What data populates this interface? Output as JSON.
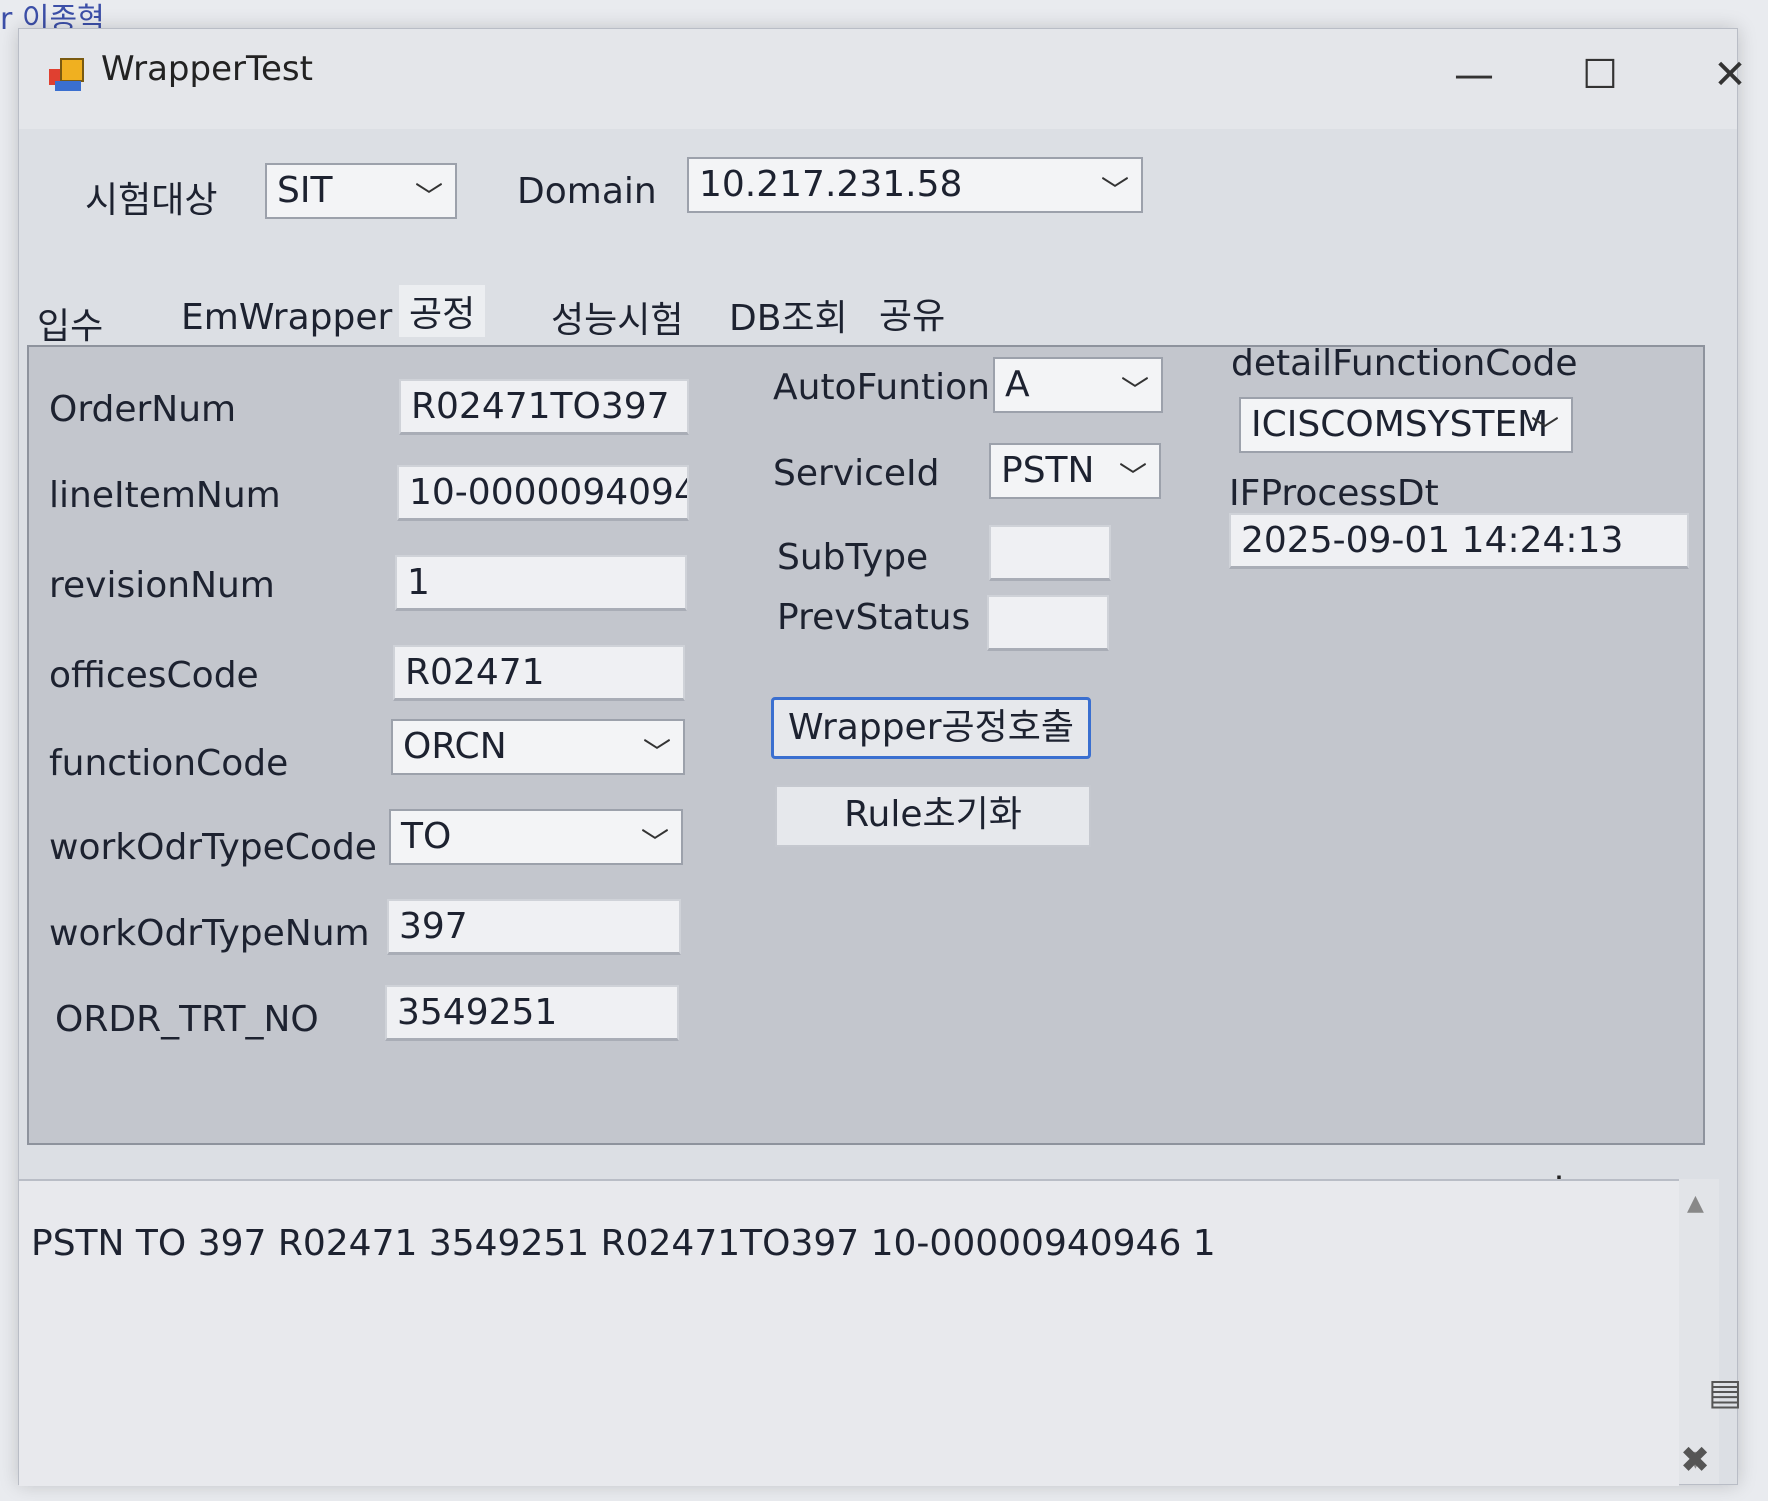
{
  "background": {
    "corner_text": "r 이종혁"
  },
  "window": {
    "title": "WrapperTest",
    "controls": {
      "minimize": "—",
      "maximize": "☐",
      "close": "✕"
    }
  },
  "top": {
    "target_label": "시험대상",
    "target_value": "SIT",
    "domain_label": "Domain",
    "domain_value": "10.217.231.58"
  },
  "tabs": [
    "입수",
    "EmWrapper",
    "공정",
    "성능시험",
    "DB조회",
    "공유"
  ],
  "form": {
    "order_num_label": "OrderNum",
    "order_num": "R02471TO397",
    "line_item_label": "lineItemNum",
    "line_item": "10-00000940946",
    "revision_label": "revisionNum",
    "revision": "1",
    "offices_label": "officesCode",
    "offices": "R02471",
    "function_label": "functionCode",
    "function": "ORCN",
    "work_type_code_label": "workOdrTypeCode",
    "work_type_code": "TO",
    "work_type_num_label": "workOdrTypeNum",
    "work_type_num": "397",
    "ordr_label": "ORDR_TRT_NO",
    "ordr": "3549251",
    "auto_label": "AutoFuntion",
    "auto": "A",
    "service_label": "ServiceId",
    "service": "PSTN",
    "subtype_label": "SubType",
    "subtype": "",
    "prev_label": "PrevStatus",
    "prev": "",
    "detail_label": "detailFunctionCode",
    "detail": "ICISCOMSYSTEM",
    "if_label": "IFProcessDt",
    "if_value": "2025-09-01 14:24:13"
  },
  "buttons": {
    "wrapper_call": "Wrapper공정호출",
    "rule_reset": "Rule초기화"
  },
  "output": {
    "line": "PSTN TO 397 R02471 3549251 R02471TO397 10-00000940946 1"
  },
  "colors": {
    "accent": "#3a6fd0",
    "panel": "#c3c6cd",
    "window": "#dcdfe4"
  }
}
